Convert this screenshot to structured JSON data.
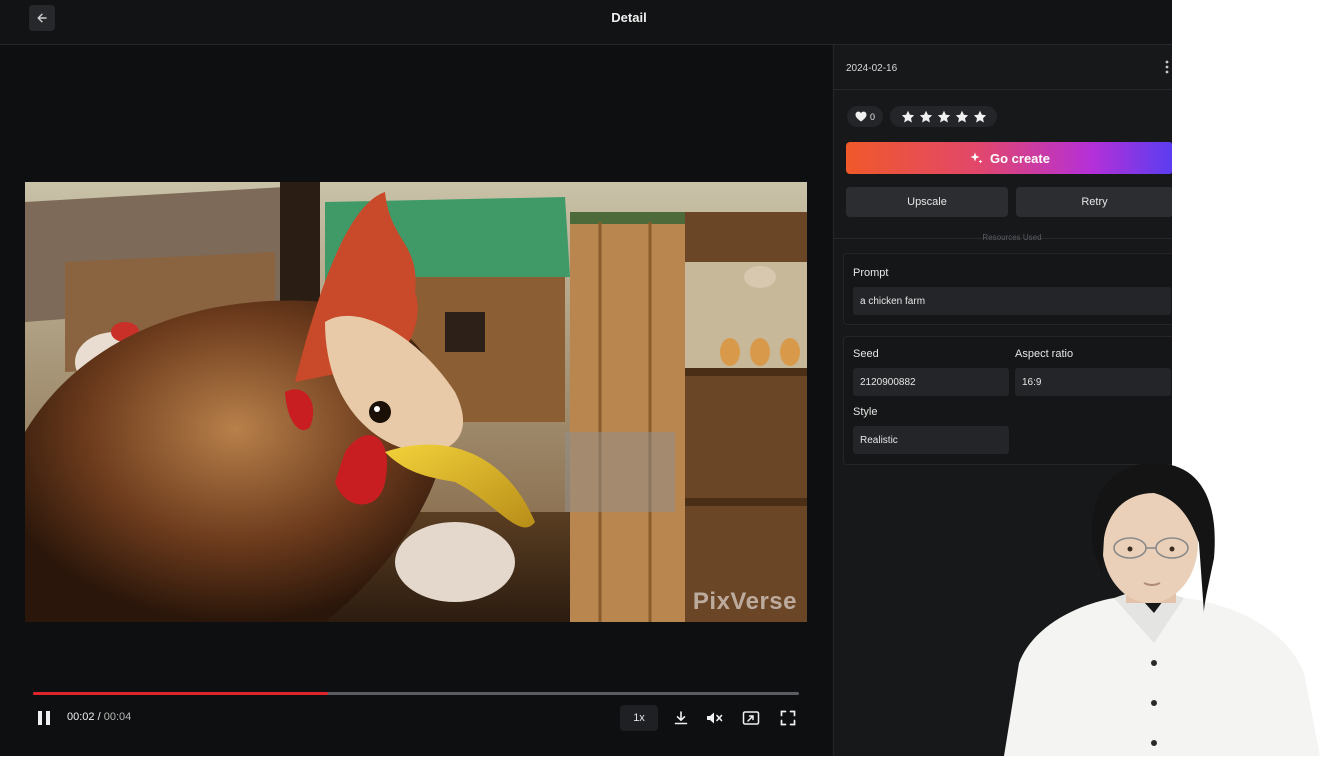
{
  "header": {
    "title": "Detail",
    "back_icon": "arrow-left-icon"
  },
  "video": {
    "watermark": "PixVerse",
    "progress": 0.385,
    "current_time": "00:02",
    "time_separator": "/",
    "duration": "00:04",
    "speed": "1x",
    "accent_color": "#e0242c"
  },
  "panel": {
    "date": "2024-02-16",
    "likes": "0",
    "stars": 5,
    "go_create_label": "Go create",
    "upscale_label": "Upscale",
    "retry_label": "Retry",
    "resources_label": "Resources Used",
    "prompt": {
      "label": "Prompt",
      "value": "a chicken farm"
    },
    "seed": {
      "label": "Seed",
      "value": "2120900882"
    },
    "aspect_ratio": {
      "label": "Aspect ratio",
      "value": "16:9"
    },
    "style": {
      "label": "Style",
      "value": "Realistic"
    }
  }
}
